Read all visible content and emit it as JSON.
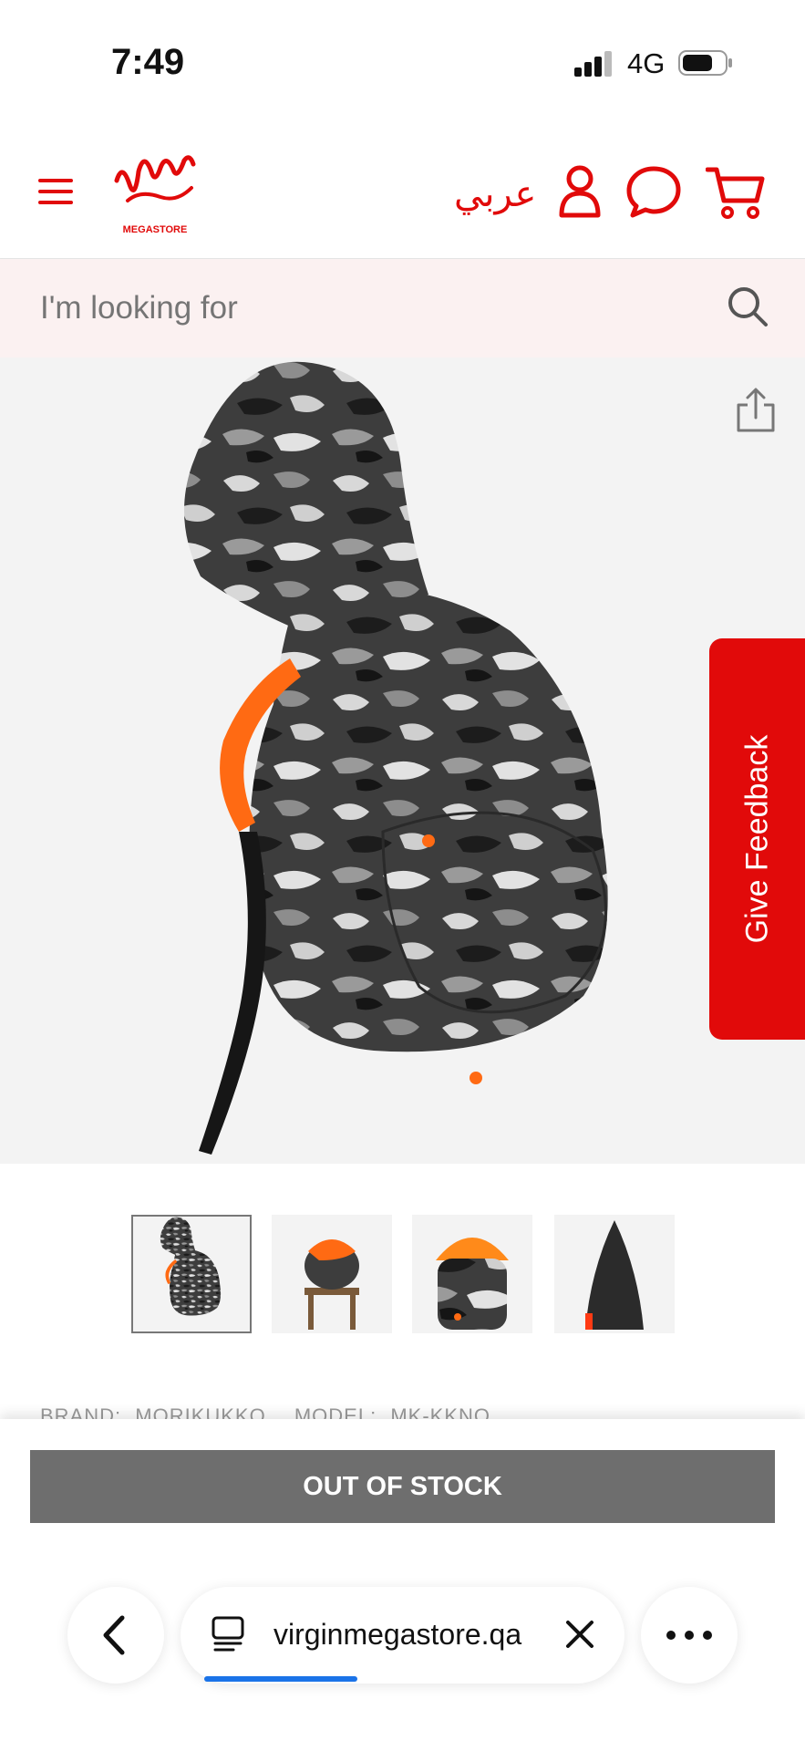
{
  "status_bar": {
    "time": "7:49",
    "network": "4G"
  },
  "header": {
    "language_label": "عربي",
    "logo_alt": "Virgin Megastore"
  },
  "search": {
    "placeholder": "I'm looking for"
  },
  "feedback": {
    "label": "Give Feedback"
  },
  "gallery": {
    "selected_index": 0,
    "thumbnail_count": 4
  },
  "product": {
    "brand_label": "BRAND:",
    "brand_value": "MORIKUKKO",
    "model_label": "MODEL:",
    "model_value": "MK-KKNO"
  },
  "actions": {
    "out_of_stock_label": "OUT OF STOCK"
  },
  "browser": {
    "url": "virginmegastore.qa",
    "load_progress": 0.33
  },
  "colors": {
    "brand_red": "#e10a0a",
    "search_bg": "#fbf1f1",
    "button_grey": "#6e6e6e",
    "progress_blue": "#1a73e8"
  }
}
